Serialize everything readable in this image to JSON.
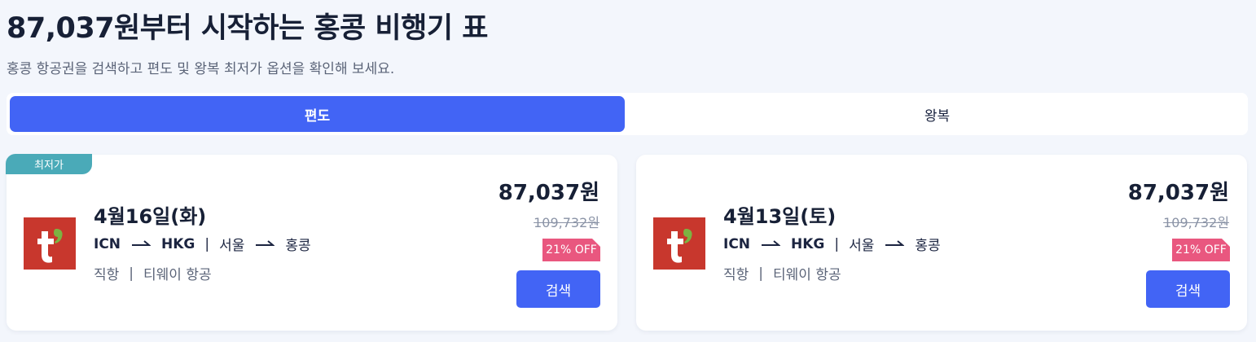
{
  "header": {
    "title": "87,037원부터 시작하는 홍콩 비행기 표",
    "subtitle": "홍콩 항공권을 검색하고 편도 및 왕복 최저가 옵션을 확인해 보세요."
  },
  "tabs": [
    {
      "label": "편도",
      "active": true
    },
    {
      "label": "왕복",
      "active": false
    }
  ],
  "cards": [
    {
      "badge": "최저가",
      "date": "4월16일(화)",
      "origin_code": "ICN",
      "dest_code": "HKG",
      "origin_city": "서울",
      "dest_city": "홍콩",
      "route_sep": "|",
      "flight_type": "직항",
      "info_sep": "|",
      "airline": "티웨이 항공",
      "price": "87,037원",
      "original_price": "109,732원",
      "discount": "21% OFF",
      "search_label": "검색"
    },
    {
      "date": "4월13일(토)",
      "origin_code": "ICN",
      "dest_code": "HKG",
      "origin_city": "서울",
      "dest_city": "홍콩",
      "route_sep": "|",
      "flight_type": "직항",
      "info_sep": "|",
      "airline": "티웨이 항공",
      "price": "87,037원",
      "original_price": "109,732원",
      "discount": "21% OFF",
      "search_label": "검색"
    }
  ],
  "colors": {
    "accent": "#4264f5",
    "badge": "#4aaab8",
    "discount": "#e9577f",
    "airline_logo": "#c8372d",
    "logo_apostrophe": "#7cb342"
  },
  "icons": {
    "route_arrow": "arrow-right-icon",
    "airline_logo": "tway-logo"
  }
}
